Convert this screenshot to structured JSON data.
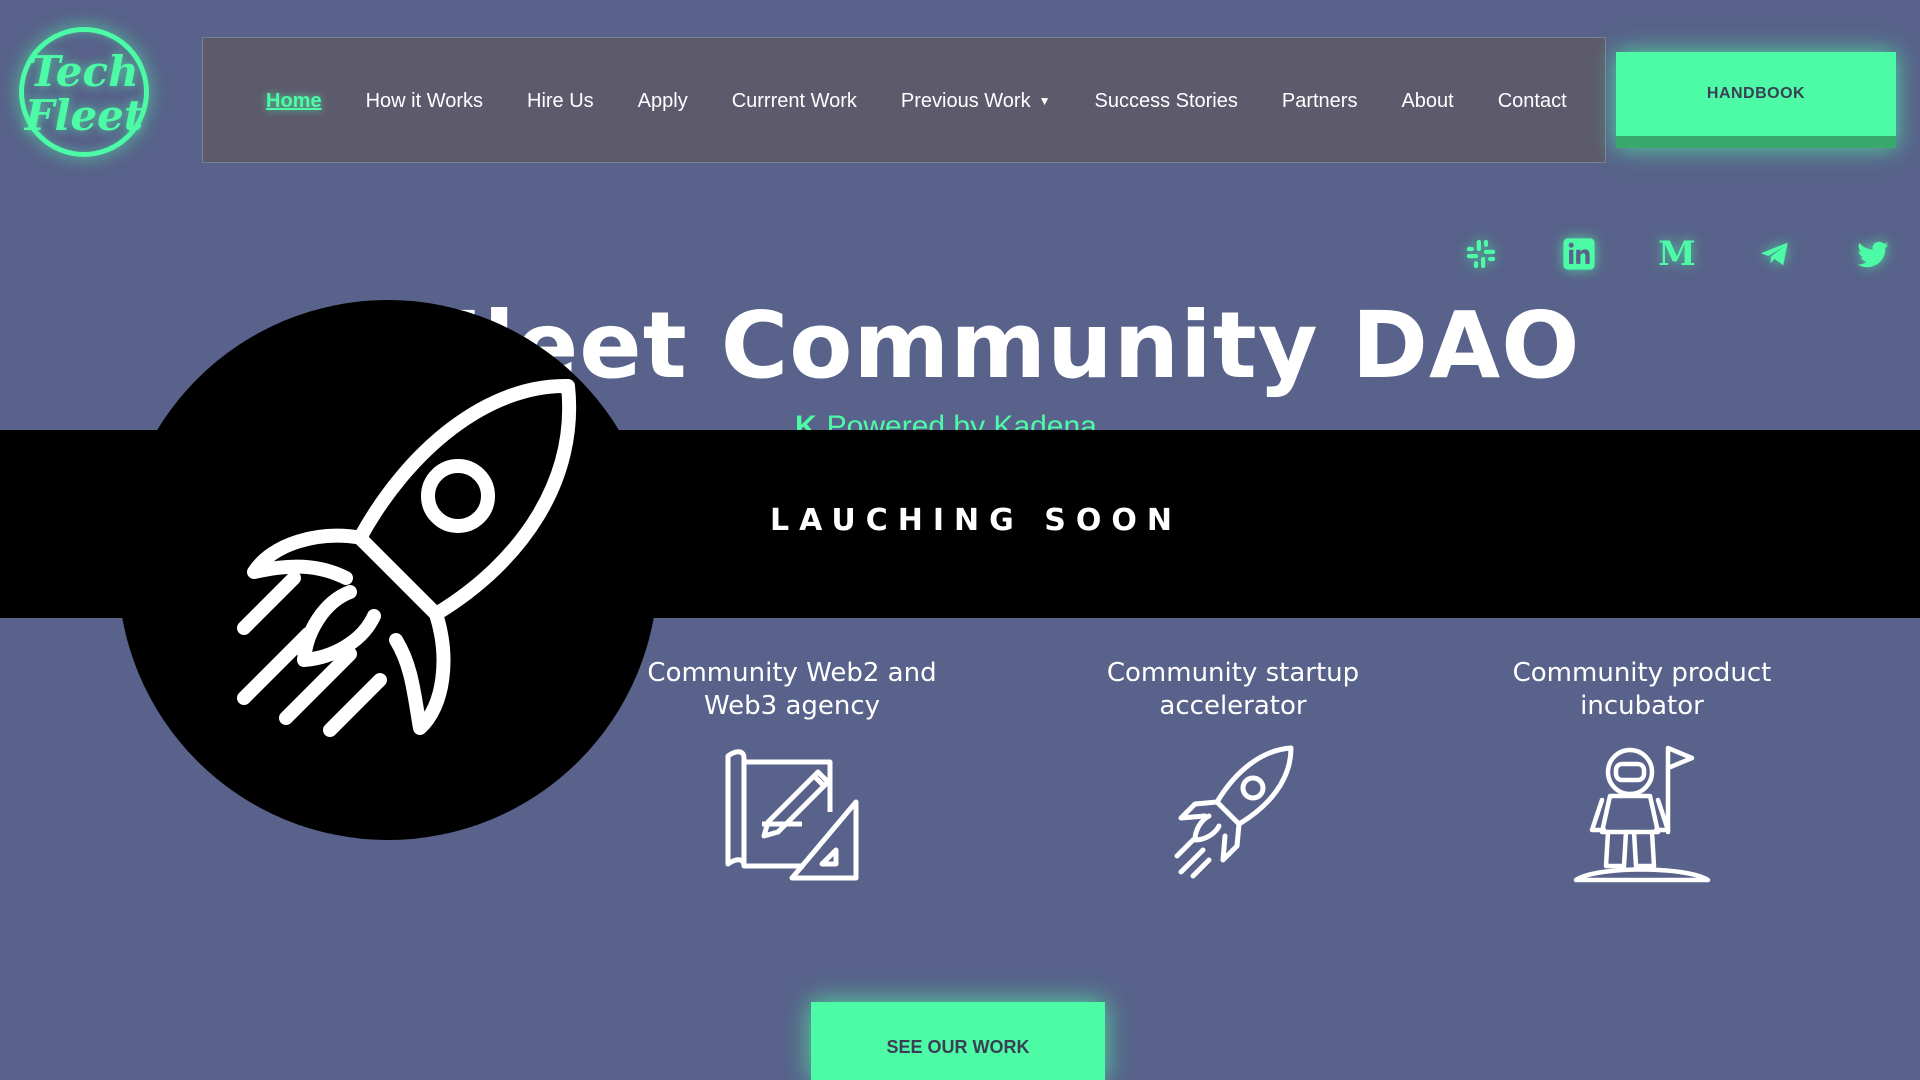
{
  "logo": {
    "line1": "Tech",
    "line2": "Fleet"
  },
  "nav": {
    "items": [
      {
        "label": "Home",
        "active": true
      },
      {
        "label": "How it Works"
      },
      {
        "label": "Hire Us"
      },
      {
        "label": "Apply"
      },
      {
        "label": "Currrent Work"
      },
      {
        "label": "Previous Work",
        "dropdown": true
      },
      {
        "label": "Success Stories"
      },
      {
        "label": "Partners"
      },
      {
        "label": "About"
      },
      {
        "label": "Contact"
      }
    ],
    "handbook_label": "HANDBOOK"
  },
  "socials": [
    "slack-icon",
    "linkedin-icon",
    "medium-icon",
    "telegram-icon",
    "twitter-icon"
  ],
  "hero": {
    "title": "Fleet Community DAO",
    "powered_k": "K",
    "powered_text": "Powered by Kadena"
  },
  "banner": {
    "text": "LAUCHING SOON"
  },
  "features": [
    {
      "line1": "Community Web2 and",
      "line2": "Web3 agency",
      "icon": "blueprint-icon"
    },
    {
      "line1": "Community startup",
      "line2": "accelerator",
      "icon": "rocket-icon"
    },
    {
      "line1": "Community product",
      "line2": "incubator",
      "icon": "astronaut-icon"
    }
  ],
  "cta": {
    "label": "SEE OUR WORK"
  },
  "colors": {
    "accent": "#4dfba6",
    "background": "#58628a",
    "navbar": "#5d5a6c",
    "banner": "#000000"
  }
}
